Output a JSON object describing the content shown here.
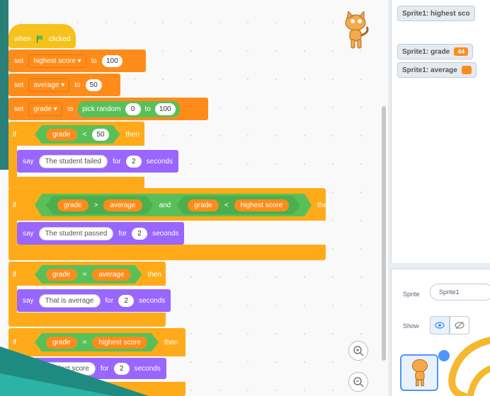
{
  "script": {
    "hat": {
      "when": "when",
      "clicked": "clicked"
    },
    "set1": {
      "set": "set",
      "var": "highest score",
      "to": "to",
      "value": "100"
    },
    "set2": {
      "set": "set",
      "var": "average",
      "to": "to",
      "value": "50"
    },
    "set3": {
      "set": "set",
      "var": "grade",
      "to": "to",
      "op": "pick random",
      "from": "0",
      "to2": "to",
      "max": "100"
    },
    "if1": {
      "if": "if",
      "left": "grade",
      "op": "<",
      "right": "50",
      "then": "then",
      "say": "say",
      "msg": "The student failed",
      "for": "for",
      "secs": "2",
      "seconds": "seconds"
    },
    "if2": {
      "if": "if",
      "a_left": "grade",
      "a_op": ">",
      "a_right": "average",
      "and": "and",
      "b_left": "grade",
      "b_op": "<",
      "b_right": "highest score",
      "then": "then",
      "say": "say",
      "msg": "The student passed",
      "for": "for",
      "secs": "2",
      "seconds": "seconds"
    },
    "if3": {
      "if": "if",
      "left": "grade",
      "op": "=",
      "right": "average",
      "then": "then",
      "say": "say",
      "msg": "That is average",
      "for": "for",
      "secs": "2",
      "seconds": "seconds"
    },
    "if4": {
      "if": "if",
      "left": "grade",
      "op": "=",
      "right": "highest score",
      "then": "then",
      "msg": "Perfect score",
      "for": "for",
      "secs": "2",
      "seconds": "seconds"
    }
  },
  "monitors": [
    {
      "label": "Sprite1: highest sco",
      "value": ""
    },
    {
      "label": "Sprite1: grade",
      "value": "44"
    },
    {
      "label": "Sprite1: average",
      "value": ""
    }
  ],
  "sprite_info": {
    "sprite_label": "Sprite",
    "sprite_name": "Sprite1",
    "show_label": "Show"
  },
  "zoom": {
    "in": "+",
    "out": "−"
  },
  "colors": {
    "events": "#f5c21b",
    "variables": "#ff8c1a",
    "control": "#ffab19",
    "operators": "#59c059",
    "looks": "#9966ff",
    "teal": "#1f8a80"
  }
}
